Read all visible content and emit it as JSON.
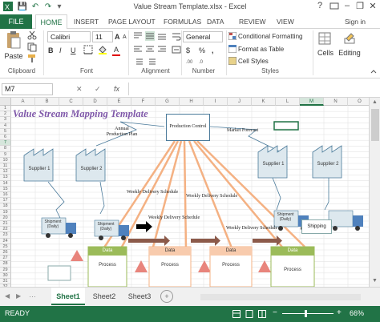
{
  "window": {
    "title": "Value Stream Template.xlsx - Excel",
    "question": "?",
    "minimize": "–",
    "restore": "❐",
    "close": "✕"
  },
  "quick_access": {
    "save": "💾",
    "undo": "↶",
    "redo": "↷",
    "customize": "▾"
  },
  "tabs": {
    "file": "FILE",
    "home": "HOME",
    "insert": "INSERT",
    "page_layout": "PAGE LAYOUT",
    "formulas": "FORMULAS",
    "data": "DATA",
    "review": "REVIEW",
    "view": "VIEW",
    "sign_in": "Sign in"
  },
  "ribbon": {
    "clipboard": {
      "paste": "Paste",
      "label": "Clipboard"
    },
    "font": {
      "name": "Calibri",
      "size": "11",
      "bold": "B",
      "italic": "I",
      "underline": "U",
      "grow": "A",
      "shrink": "A",
      "font_color": "A",
      "label": "Font"
    },
    "alignment": {
      "label": "Alignment"
    },
    "number": {
      "format": "General",
      "currency": "$",
      "percent": "%",
      "comma": ",",
      "label": "Number"
    },
    "styles": {
      "conditional": "Conditional Formatting",
      "format_table": "Format as Table",
      "cell_styles": "Cell Styles",
      "label": "Styles"
    },
    "cells": {
      "label": "Cells"
    },
    "editing": {
      "label": "Editing"
    }
  },
  "formula_bar": {
    "name_box": "M7",
    "cancel": "✕",
    "enter": "✓",
    "fx": "fx",
    "value": ""
  },
  "columns": [
    "A",
    "B",
    "C",
    "D",
    "E",
    "F",
    "G",
    "H",
    "I",
    "J",
    "K",
    "L",
    "M",
    "N",
    "O",
    "P"
  ],
  "rows": [
    "1",
    "2",
    "3",
    "4",
    "5",
    "6",
    "7",
    "8",
    "9",
    "10",
    "11",
    "12",
    "13",
    "14",
    "15",
    "16",
    "17",
    "18",
    "19",
    "20",
    "21",
    "22",
    "23",
    "24",
    "25",
    "26",
    "27",
    "28",
    "29",
    "30",
    "31",
    "32"
  ],
  "sheet": {
    "title": "Value Stream Mapping Template",
    "production_control": "Production Control",
    "annual_plan": "Annual Production Plan",
    "market_forecast": "Market Forecast",
    "supplier1": "Supplier 1",
    "supplier2": "Supplier 2",
    "supplier1_right": "Supplier 1",
    "supplier2_right": "Supplier 2",
    "weekly_schedule": "Weekly Delivery Schedule",
    "shipment": "Shipment (Daily)",
    "shipping": "Shipping",
    "data_label": "Data",
    "process_label": "Process"
  },
  "sheet_tabs": {
    "sheet1": "Sheet1",
    "sheet2": "Sheet2",
    "sheet3": "Sheet3",
    "add": "+"
  },
  "status": {
    "ready": "READY",
    "zoom": "66%"
  },
  "colors": {
    "excel_green": "#217346",
    "process_fill": "#9bbb59",
    "data_fill": "#f8cbad",
    "arrow_orange": "#f4b183"
  }
}
